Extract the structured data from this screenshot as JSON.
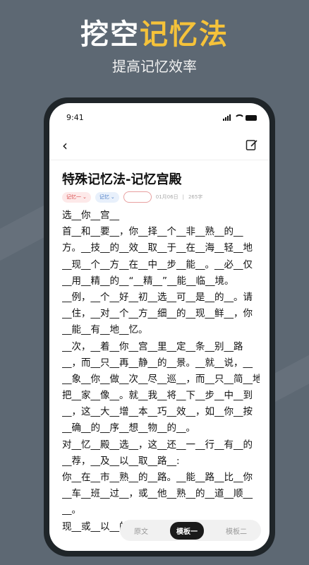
{
  "promo": {
    "title_part1": "挖空",
    "title_part2": "记忆法",
    "subtitle": "提高记忆效率"
  },
  "status_bar": {
    "time": "9:41"
  },
  "note": {
    "title": "特殊记忆法-记忆宫殿",
    "tag1": "记忆一",
    "tag2": "记忆",
    "date": "01月06日",
    "word_count": "265字"
  },
  "content_lines": [
    "选__你__宫__",
    "首__和__要__，你__择__个__非__熟__的__",
    "方。__技__的__效__取__于__在__海__轻__地",
    "__现__个__方__在__中__步__能__。__必__仅",
    "__用__精__的__“__精__”__能__临__境。",
    "__例，__个__好__初__选__可__是__的__。请",
    "__住，__对__个__方__细__的__现__鲜__，你",
    "__能__有__地__忆。",
    "__次，__着__你__宫__里__定__条__别__路",
    "__，而__只__再__静__的__景。__就__说，__",
    "__象__你__做__次__尽__巡__，而__只__简__地",
    "把__家__像__。就__我__将__下__步__中__到",
    "__，这__大__增__本__巧__效__，如__你__按",
    "__确__的__序__想__物__的__。",
    "对__忆__殿__选__，这__还__一__行__有__的",
    "__荐，__及__以__取__路__:",
    "你__在__市__熟__的__路。__能__路__比__你",
    "__车__班__过__，或__他__熟__的__道__顺__",
    "__。",
    "现__或__以__的__校。__可__想__从__室__图"
  ],
  "tabs": [
    "原文",
    "模板一",
    "模板二"
  ]
}
